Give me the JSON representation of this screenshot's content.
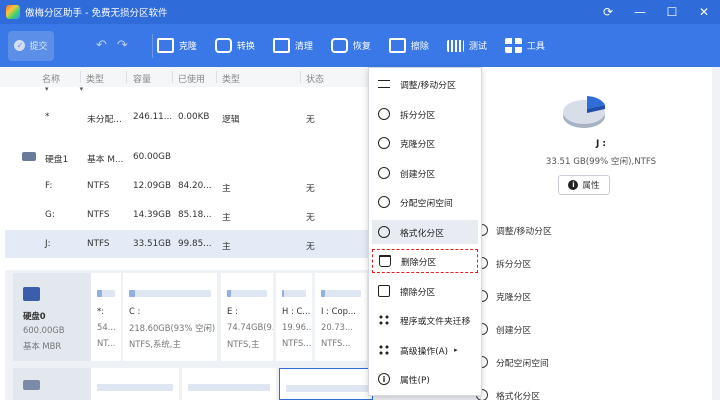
{
  "window": {
    "title": "傲梅分区助手 - 免费无损分区软件"
  },
  "window_buttons": [
    "⟳",
    "—",
    "☐",
    "✕"
  ],
  "toolbar": {
    "commit": "提交",
    "items": [
      {
        "label": "克隆",
        "icon": "clone-icon"
      },
      {
        "label": "转换",
        "icon": "convert-icon"
      },
      {
        "label": "清理",
        "icon": "clean-icon"
      },
      {
        "label": "恢复",
        "icon": "recover-icon"
      },
      {
        "label": "擦除",
        "icon": "wipe-icon"
      },
      {
        "label": "测试",
        "icon": "test-icon"
      },
      {
        "label": "工具",
        "icon": "tools-icon"
      }
    ]
  },
  "table": {
    "headers": [
      "名称",
      "类型",
      "容量",
      "已使用",
      "类型",
      "状态"
    ],
    "rows": [
      {
        "name": "*",
        "type": "未分配...",
        "capacity": "246.11...",
        "used": "0.00KB",
        "fstype": "逻辑",
        "status": "无"
      },
      {
        "name": "硬盘1",
        "type": "基本 M...",
        "capacity": "60.00GB",
        "used": "",
        "fstype": "",
        "status": "",
        "is_disk": true
      },
      {
        "name": "F:",
        "type": "NTFS",
        "capacity": "12.09GB",
        "used": "84.20...",
        "fstype": "主",
        "status": "无"
      },
      {
        "name": "G:",
        "type": "NTFS",
        "capacity": "14.39GB",
        "used": "85.18...",
        "fstype": "主",
        "status": "无"
      },
      {
        "name": "J:",
        "type": "NTFS",
        "capacity": "33.51GB",
        "used": "99.85...",
        "fstype": "主",
        "status": "无",
        "selected": true
      }
    ]
  },
  "disk0": {
    "name": "硬盘0",
    "size": "600.00GB",
    "type": "基本 MBR",
    "partitions": [
      {
        "label": "*:",
        "line2": "54...",
        "line3": "NT...",
        "fill": 0.3
      },
      {
        "label": "C :",
        "line2": "218.60GB(93% 空闲)",
        "line3": "NTFS,系统,主",
        "fill": 0.07
      },
      {
        "label": "E :",
        "line2": "74.74GB(9...",
        "line3": "NTFS,主",
        "fill": 0.1
      },
      {
        "label": "H : C...",
        "line2": "19.96...",
        "line3": "NTFS...",
        "fill": 0.1
      },
      {
        "label": "I : Cop...",
        "line2": "20.73...",
        "line3": "NTFS...",
        "fill": 0.1
      }
    ]
  },
  "right_panel": {
    "letter": "J :",
    "info": "33.51 GB(99% 空闲),NTFS",
    "attr_button": "属性",
    "operations": [
      {
        "label": "调整/移动分区",
        "icon": "resize-move-icon"
      },
      {
        "label": "拆分分区",
        "icon": "split-icon"
      },
      {
        "label": "克隆分区",
        "icon": "clone-partition-icon"
      },
      {
        "label": "创建分区",
        "icon": "create-partition-icon"
      },
      {
        "label": "分配空闲空间",
        "icon": "allocate-space-icon"
      },
      {
        "label": "格式化分区",
        "icon": "format-icon"
      }
    ]
  },
  "context_menu": {
    "items": [
      {
        "label": "调整/移动分区",
        "icon": "resize-move-icon"
      },
      {
        "label": "拆分分区",
        "icon": "split-icon"
      },
      {
        "label": "克隆分区",
        "icon": "clone-partition-icon"
      },
      {
        "label": "创建分区",
        "icon": "create-partition-icon"
      },
      {
        "label": "分配空闲空间",
        "icon": "allocate-space-icon"
      },
      {
        "label": "格式化分区",
        "icon": "format-icon"
      },
      {
        "label": "删除分区",
        "icon": "delete-icon"
      },
      {
        "label": "擦除分区",
        "icon": "wipe-icon"
      },
      {
        "label": "程序或文件夹迁移",
        "icon": "app-mover-icon"
      },
      {
        "label": "高级操作(A)",
        "icon": "more-icon",
        "submenu_arrow": "▸"
      },
      {
        "label": "属性(P)",
        "icon": "info-icon"
      }
    ]
  },
  "colors": {
    "titlebar": "#2f6bd9",
    "toolbar": "#3a78e8",
    "accent": "#3a78e8",
    "delete_highlight": "#e01e1e",
    "selected_row": "#e4ebf7"
  }
}
